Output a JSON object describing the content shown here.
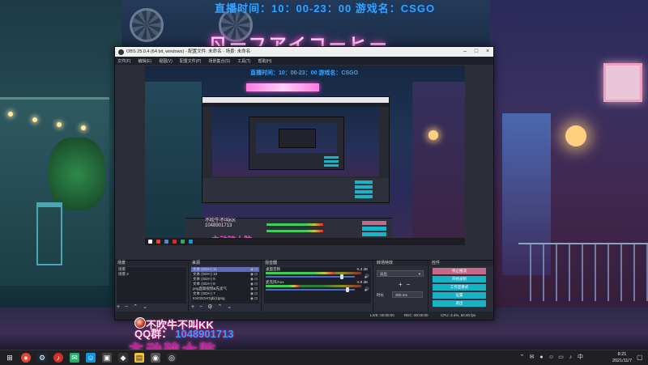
{
  "overlay": {
    "stream_header": "直播时间：10：00-23：00 游戏名：CSGO",
    "neon_sign": "ㄖーフアイコーヒー",
    "nickname_line": "不吹牛不叫KK",
    "qq_label": "QQ群：",
    "qq_number": "1048901713",
    "big_text": "主动破大防"
  },
  "obs": {
    "title": "OBS 25.0.4 (64 bit, windows) - 配置文件: 未命名 - 场景: 未命名",
    "menu": [
      "文件(F)",
      "编辑(E)",
      "视图(V)",
      "配置文件(P)",
      "场景集合(S)",
      "工具(T)",
      "帮助(H)"
    ],
    "docks": {
      "scenes": {
        "title": "场景",
        "items": [
          "场景",
          "场景 2"
        ]
      },
      "sources": {
        "title": "来源",
        "items": [
          "文本 (GDI+) 11",
          "文本 (GDI+) 10",
          "文本 (GDI+) 9",
          "文本 (GDI+) 8",
          "png直联视频&先卖气",
          "文本 (GDI+) 7",
          "KSCEGH7gb(1)png"
        ]
      },
      "mixer": {
        "title": "混音器",
        "items": [
          {
            "name": "桌面音频",
            "db": "-5.3 dB",
            "level": 0.72,
            "volume": 0.85
          },
          {
            "name": "麦克风/Aux",
            "db": "-3.8 dB",
            "level": 0.35,
            "volume": 0.92
          }
        ]
      },
      "transitions": {
        "title": "转场特效",
        "selected": "淡出",
        "duration_label": "时长",
        "duration": "300 ms"
      },
      "controls": {
        "title": "控件",
        "buttons": [
          "停止推流",
          "开始录制",
          "工作室模式",
          "设置",
          "退出"
        ]
      }
    },
    "status": {
      "live": "LIVE: 00:00:00",
      "rec": "REC: 00:00:00",
      "cpu": "CPU: 3.4%, 60.00 fps"
    }
  },
  "taskbar": {
    "time": "8:21",
    "date": "2021/11/7",
    "apps": [
      "windows-logo",
      "chrome-icon",
      "steam-icon",
      "netease-music-icon",
      "wechat-icon",
      "qq-icon",
      "monitor-app-icon",
      "file-explorer-icon",
      "game-icon",
      "obs-icon"
    ],
    "colors": {
      "chrome": "#e94335",
      "netease": "#d0322a",
      "wechat": "#2aae67",
      "qq": "#1296db",
      "explorer": "#f5c342",
      "accent": "#14b4c6"
    }
  }
}
